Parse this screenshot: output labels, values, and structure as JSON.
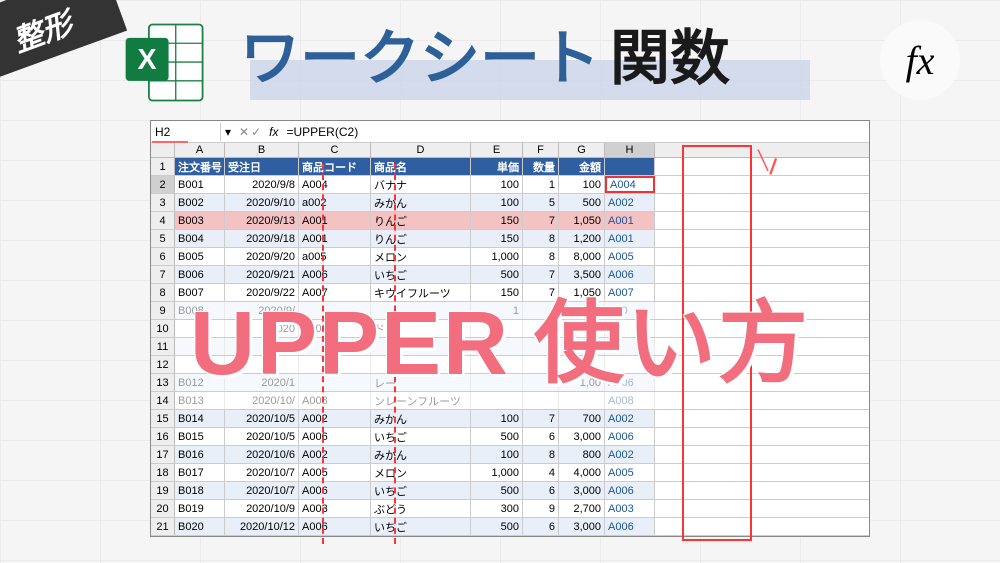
{
  "badge": "整形",
  "title": {
    "part1": "ワークシート",
    "part2": "関数"
  },
  "fx_badge": "fx",
  "namebox": "H2",
  "formula": "=UPPER(C2)",
  "fx_label": "fx",
  "columns": [
    "A",
    "B",
    "C",
    "D",
    "E",
    "F",
    "G",
    "H"
  ],
  "headers": {
    "order_no": "注文番号",
    "order_date": "受注日",
    "code": "商品コード",
    "name": "商品名",
    "price": "単価",
    "qty": "数量",
    "amount": "金額",
    "h": ""
  },
  "rows": [
    {
      "n": 2,
      "a": "B001",
      "b": "2020/9/8",
      "c": "A004",
      "d": "バナナ",
      "e": "100",
      "f": "1",
      "g": "100",
      "h": "A004"
    },
    {
      "n": 3,
      "a": "B002",
      "b": "2020/9/10",
      "c": "a002",
      "d": "みかん",
      "e": "100",
      "f": "5",
      "g": "500",
      "h": "A002"
    },
    {
      "n": 4,
      "a": "B003",
      "b": "2020/9/13",
      "c": "A001",
      "d": "りんご",
      "e": "150",
      "f": "7",
      "g": "1,050",
      "h": "A001",
      "hi": true
    },
    {
      "n": 5,
      "a": "B004",
      "b": "2020/9/18",
      "c": "A001",
      "d": "りんご",
      "e": "150",
      "f": "8",
      "g": "1,200",
      "h": "A001"
    },
    {
      "n": 6,
      "a": "B005",
      "b": "2020/9/20",
      "c": "a005",
      "d": "メロン",
      "e": "1,000",
      "f": "8",
      "g": "8,000",
      "h": "A005"
    },
    {
      "n": 7,
      "a": "B006",
      "b": "2020/9/21",
      "c": "A006",
      "d": "いちご",
      "e": "500",
      "f": "7",
      "g": "3,500",
      "h": "A006"
    },
    {
      "n": 8,
      "a": "B007",
      "b": "2020/9/22",
      "c": "A007",
      "d": "キウイフルーツ",
      "e": "150",
      "f": "7",
      "g": "1,050",
      "h": "A007"
    },
    {
      "n": 9,
      "a": "B008",
      "b": "2020/9/",
      "c": "",
      "d": "",
      "e": "1",
      "f": "",
      "g": "900",
      "h": "A00"
    },
    {
      "n": 10,
      "a": "",
      "b": "2020",
      "c": "A009",
      "d": "ド",
      "e": "",
      "f": "10",
      "g": "",
      "h": "A"
    },
    {
      "n": 11,
      "a": "",
      "b": "",
      "c": "",
      "d": "",
      "e": "",
      "f": "0",
      "g": "",
      "h": "04"
    },
    {
      "n": 12,
      "a": "",
      "b": "",
      "c": "",
      "d": "",
      "e": "",
      "f": "",
      "g": "",
      "h": ""
    },
    {
      "n": 13,
      "a": "B012",
      "b": "2020/1",
      "c": "",
      "d": "レー",
      "e": "",
      "f": "",
      "g": "1,00",
      "h": "A006"
    },
    {
      "n": 14,
      "a": "B013",
      "b": "2020/10/",
      "c": "A008",
      "d": "ンレーンフルーツ",
      "e": "",
      "f": "",
      "g": "",
      "h": "A008"
    },
    {
      "n": 15,
      "a": "B014",
      "b": "2020/10/5",
      "c": "A002",
      "d": "みかん",
      "e": "100",
      "f": "7",
      "g": "700",
      "h": "A002"
    },
    {
      "n": 16,
      "a": "B015",
      "b": "2020/10/5",
      "c": "A006",
      "d": "いちご",
      "e": "500",
      "f": "6",
      "g": "3,000",
      "h": "A006"
    },
    {
      "n": 17,
      "a": "B016",
      "b": "2020/10/6",
      "c": "A002",
      "d": "みかん",
      "e": "100",
      "f": "8",
      "g": "800",
      "h": "A002"
    },
    {
      "n": 18,
      "a": "B017",
      "b": "2020/10/7",
      "c": "A005",
      "d": "メロン",
      "e": "1,000",
      "f": "4",
      "g": "4,000",
      "h": "A005"
    },
    {
      "n": 19,
      "a": "B018",
      "b": "2020/10/7",
      "c": "A006",
      "d": "いちご",
      "e": "500",
      "f": "6",
      "g": "3,000",
      "h": "A006"
    },
    {
      "n": 20,
      "a": "B019",
      "b": "2020/10/9",
      "c": "A003",
      "d": "ぶどう",
      "e": "300",
      "f": "9",
      "g": "2,700",
      "h": "A003"
    },
    {
      "n": 21,
      "a": "B020",
      "b": "2020/10/12",
      "c": "A006",
      "d": "いちご",
      "e": "500",
      "f": "6",
      "g": "3,000",
      "h": "A006"
    }
  ],
  "overlay": {
    "upper": "UPPER",
    "usage": "使い方"
  }
}
